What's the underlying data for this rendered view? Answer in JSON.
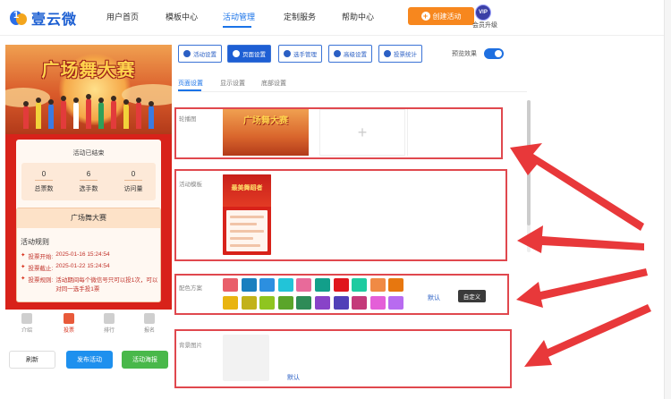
{
  "brand": {
    "name": "壹云微"
  },
  "nav": {
    "items": [
      "用户首页",
      "模板中心",
      "活动管理",
      "定制服务",
      "帮助中心"
    ],
    "active_index": 2
  },
  "header": {
    "create_label": "创建活动",
    "vip_badge": "VIP",
    "vip_label": "会员升级"
  },
  "preview": {
    "banner_title": "广场舞大赛",
    "status_text": "活动已结束",
    "stats": [
      {
        "value": "0",
        "label": "总票数"
      },
      {
        "value": "6",
        "label": "选手数"
      },
      {
        "value": "0",
        "label": "访问量"
      }
    ],
    "info_title": "广场舞大赛",
    "rules_title": "活动规则",
    "rules": [
      {
        "key": "投票开始:",
        "value": "2025-01-16 15:24:54"
      },
      {
        "key": "投票截止:",
        "value": "2025-01-22 15:24:54"
      },
      {
        "key": "投票规则:",
        "value": "活动期间每个微信号只可以投1次，可以对同一选手投1票"
      }
    ],
    "tabs": [
      "介绍",
      "投票",
      "排行",
      "报名"
    ],
    "active_tab": 1
  },
  "actions": {
    "refresh": "刷新",
    "publish": "发布活动",
    "poster": "活动海报"
  },
  "toolbar": {
    "buttons": [
      "活动设置",
      "页面设置",
      "选手管理",
      "高级设置",
      "投票统计"
    ],
    "active_index": 1,
    "preview_label": "预览效果",
    "preview_on": true
  },
  "subtabs": {
    "items": [
      "页面设置",
      "显示设置",
      "底部设置"
    ],
    "active_index": 0
  },
  "sections": {
    "carousel_label": "轮播图",
    "template_label": "活动模板",
    "template_title": "最美舞蹈者",
    "color_label": "配色方案",
    "color_default": "默认",
    "color_custom": "自定义",
    "swatches_row1": [
      "#e95f6a",
      "#1a7fbf",
      "#2c8fe0",
      "#22c4d8",
      "#e86a9a",
      "#129f8a",
      "#e0161d",
      "#1ecba0",
      "#f08a45",
      "#e7770f"
    ],
    "swatches_row2": [
      "#e9b410",
      "#c2b21a",
      "#8fc520",
      "#5aa52a",
      "#2e8b57",
      "#8843c8",
      "#5140b8",
      "#c43a7a",
      "#e45fd8",
      "#b86bf0"
    ],
    "bg_label": "背景图片",
    "bg_default": "默认"
  },
  "colors": {
    "accent": "#1a73e8",
    "orange": "#f7871e",
    "highlight": "#e0484e",
    "arrow": "#e8383a"
  }
}
